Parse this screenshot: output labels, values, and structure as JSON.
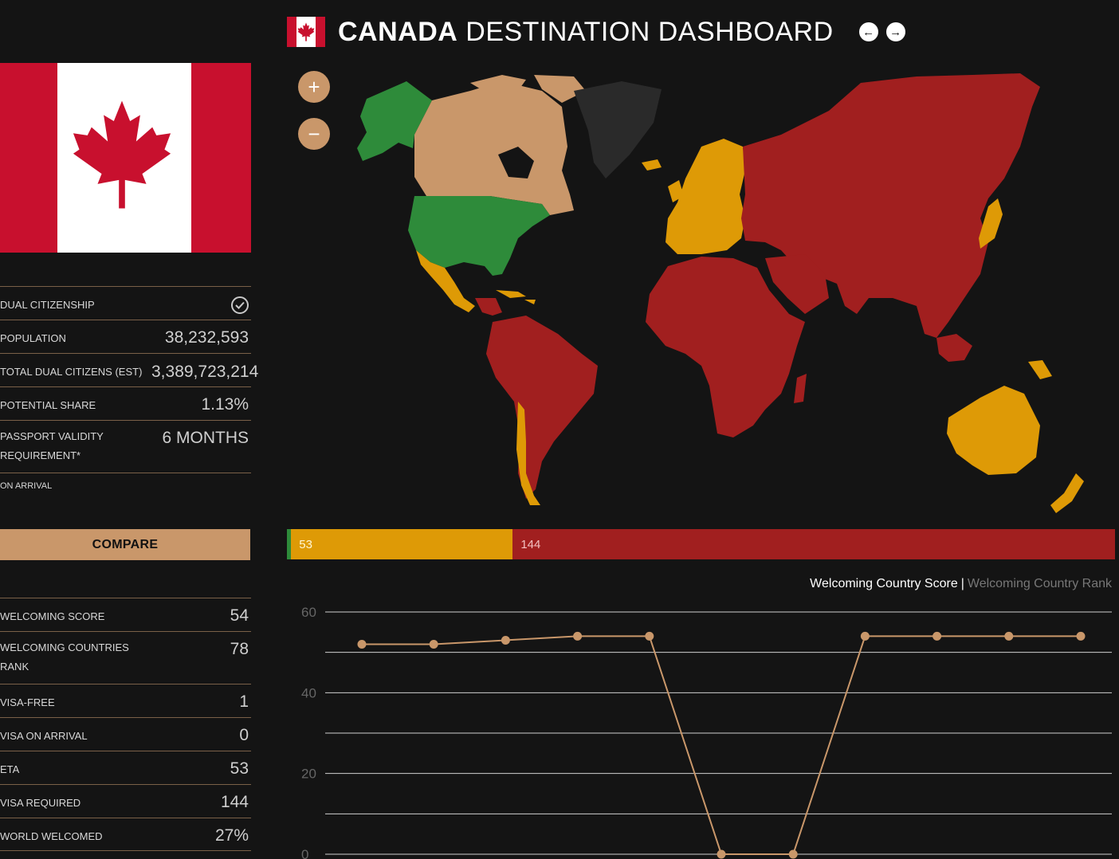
{
  "header": {
    "title_bold": "CANADA",
    "title_rest": " DESTINATION DASHBOARD",
    "prev_icon": "arrow-left-icon",
    "next_icon": "arrow-right-icon"
  },
  "colors": {
    "accent": "#c9976a",
    "visa_free": "#2e8b3a",
    "eta": "#de9a06",
    "visa_required": "#a11f1f",
    "self": "#c9976a",
    "no_data": "#2a2a2a"
  },
  "info": {
    "dual_citizenship_label": "DUAL CITIZENSHIP",
    "dual_citizenship_icon": "check-circle-icon",
    "population_label": "POPULATION",
    "population": "38,232,593",
    "total_dual_label": "TOTAL DUAL CITIZENS (EST)",
    "total_dual": "3,389,723,214",
    "potential_share_label": "POTENTIAL SHARE",
    "potential_share": "1.13%",
    "passport_validity_label_1": "PASSPORT VALIDITY",
    "passport_validity_label_2": "REQUIREMENT*",
    "passport_validity": "6 MONTHS",
    "on_arrival_note": "ON ARRIVAL"
  },
  "compare_label": "COMPARE",
  "stats": {
    "welcoming_score_label": "WELCOMING SCORE",
    "welcoming_score": "54",
    "welcoming_rank_label_1": "WELCOMING COUNTRIES",
    "welcoming_rank_label_2": "RANK",
    "welcoming_rank": "78",
    "visa_free_label": "VISA-FREE",
    "visa_free": "1",
    "visa_on_arrival_label": "VISA ON ARRIVAL",
    "visa_on_arrival": "0",
    "eta_label": "ETA",
    "eta": "53",
    "visa_required_label": "VISA REQUIRED",
    "visa_required": "144",
    "world_welcomed_label": "WORLD WELCOMED",
    "world_welcomed": "27%"
  },
  "map": {
    "zoom_in": "+",
    "zoom_out": "−"
  },
  "category_bar": {
    "segments": [
      {
        "key": "visa_free",
        "count": 1,
        "label": ""
      },
      {
        "key": "eta",
        "count": 53,
        "label": "53"
      },
      {
        "key": "visa_required",
        "count": 144,
        "label": "144"
      }
    ]
  },
  "chart_toggle": {
    "active": "Welcoming Country Score",
    "separator": "|",
    "inactive": "Welcoming Country Rank"
  },
  "chart_data": {
    "type": "line",
    "title": "",
    "xlabel": "",
    "ylabel": "",
    "x": [
      1,
      2,
      3,
      4,
      5,
      6,
      7,
      8,
      9,
      10,
      11
    ],
    "series": [
      {
        "values": [
          52,
          52,
          53,
          54,
          54,
          0,
          0,
          54,
          54,
          54,
          54
        ]
      }
    ],
    "yticks": [
      0,
      20,
      40,
      60
    ],
    "ylim": [
      0,
      60
    ],
    "grid": true,
    "line_color": "#c9976a"
  }
}
